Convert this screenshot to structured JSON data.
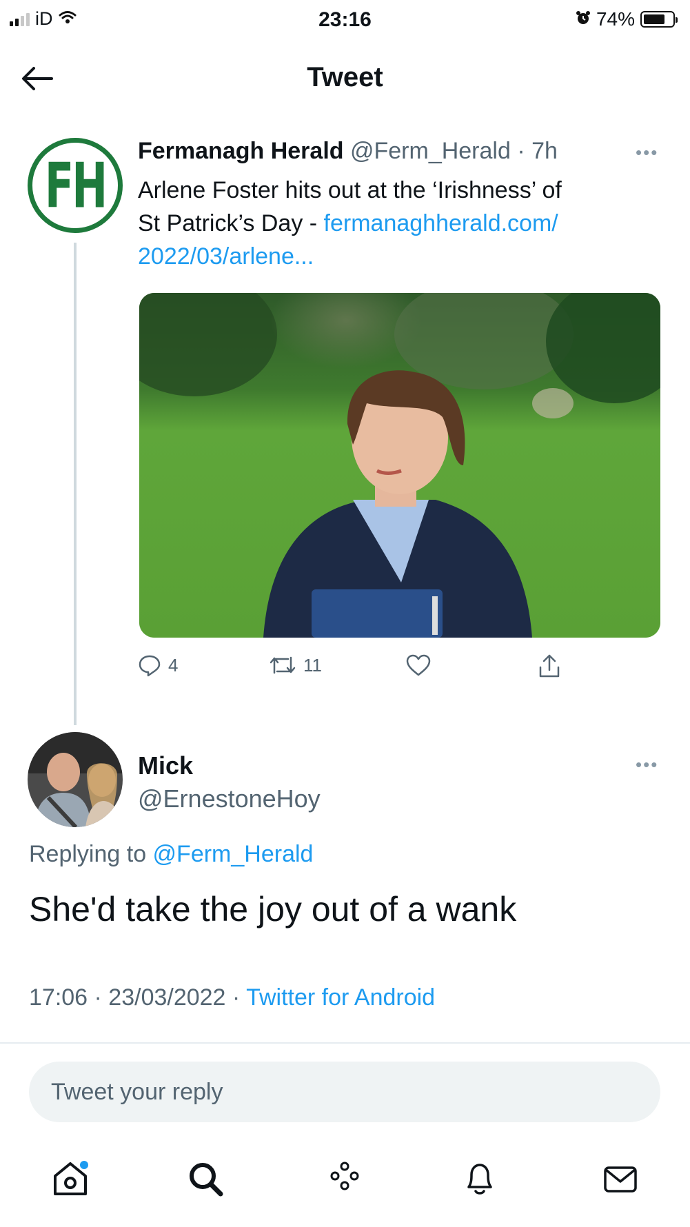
{
  "status_bar": {
    "carrier": "iD",
    "time": "23:16",
    "battery": "74%",
    "battery_level": 0.74,
    "icons": [
      "signal-icon",
      "wifi-icon",
      "alarm-icon",
      "battery-icon"
    ]
  },
  "header": {
    "title": "Tweet",
    "back_icon": "arrow-left-icon"
  },
  "original_tweet": {
    "avatar_text": "FH",
    "name": "Fermanagh Herald",
    "handle": "@Ferm_Herald",
    "time": "7h",
    "meta": " @Ferm_Herald · 7h",
    "more_dots": "•••",
    "text_line1": "Arlene Foster hits out at the ‘Irishness’ of",
    "text_line2": "St Patrick’s Day - ",
    "link_part1": "fermanaghherald.com/",
    "link_part2": "2022/03/arlene...",
    "actions": {
      "replies": "4",
      "retweets": "11",
      "likes": "",
      "icons": [
        "reply-icon",
        "retweet-icon",
        "like-icon",
        "share-icon"
      ]
    }
  },
  "reply_tweet": {
    "name": "Mick",
    "handle": "@ErnestoneHoy",
    "more_dots": "•••",
    "replying_prefix": "Replying to ",
    "replying_to": "@Ferm_Herald",
    "text": "She'd take the joy out of a wank",
    "timestamp": "17:06 · 23/03/2022 · ",
    "source": "Twitter for Android"
  },
  "reply_box": {
    "placeholder": "Tweet your reply"
  },
  "tabbar": {
    "items": [
      "home-icon",
      "search-icon",
      "spaces-icon",
      "notifications-icon",
      "messages-icon"
    ]
  },
  "colors": {
    "accent": "#1d9bf0",
    "text": "#0f1419",
    "secondary": "#536471",
    "brand_green": "#1e7a3c"
  }
}
